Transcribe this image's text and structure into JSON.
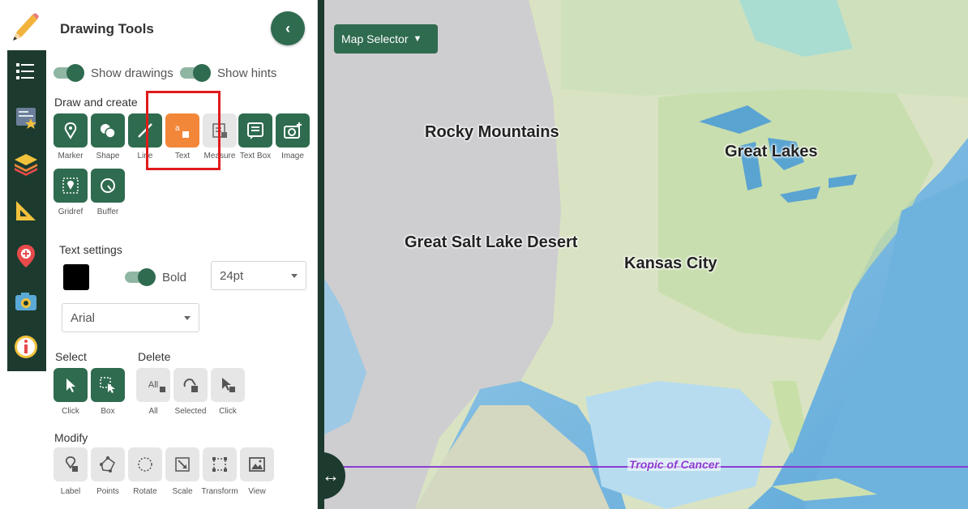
{
  "panel": {
    "title": "Drawing Tools",
    "collapse_icon": "chevron-left-icon",
    "show_drawings_label": "Show drawings",
    "show_hints_label": "Show hints"
  },
  "draw_create": {
    "heading": "Draw and create",
    "tools": [
      {
        "label": "Marker",
        "icon": "marker-icon"
      },
      {
        "label": "Shape",
        "icon": "shape-icon"
      },
      {
        "label": "Line",
        "icon": "line-icon"
      },
      {
        "label": "Text",
        "icon": "text-icon",
        "active": true
      },
      {
        "label": "Measure",
        "icon": "measure-icon"
      },
      {
        "label": "Text Box",
        "icon": "text-box-icon"
      },
      {
        "label": "Image",
        "icon": "image-icon"
      },
      {
        "label": "Gridref",
        "icon": "gridref-icon"
      },
      {
        "label": "Buffer",
        "icon": "buffer-icon"
      }
    ]
  },
  "text_settings": {
    "heading": "Text settings",
    "color": "#000000",
    "bold_label": "Bold",
    "size_value": "24pt",
    "font_value": "Arial"
  },
  "select": {
    "heading": "Select",
    "tools": [
      {
        "label": "Click",
        "icon": "cursor-icon"
      },
      {
        "label": "Box",
        "icon": "box-select-icon"
      }
    ]
  },
  "delete": {
    "heading": "Delete",
    "tools": [
      {
        "label": "All",
        "icon": "delete-all-icon",
        "glyph": "All"
      },
      {
        "label": "Selected",
        "icon": "delete-selected-icon"
      },
      {
        "label": "Click",
        "icon": "delete-click-icon"
      }
    ]
  },
  "modify": {
    "heading": "Modify",
    "tools": [
      {
        "label": "Label",
        "icon": "label-icon"
      },
      {
        "label": "Points",
        "icon": "points-icon"
      },
      {
        "label": "Rotate",
        "icon": "rotate-icon"
      },
      {
        "label": "Scale",
        "icon": "scale-icon"
      },
      {
        "label": "Transform",
        "icon": "transform-icon"
      },
      {
        "label": "View",
        "icon": "view-icon"
      }
    ]
  },
  "map": {
    "selector_label": "Map Selector",
    "labels": {
      "rocky": "Rocky Mountains",
      "lakes": "Great Lakes",
      "salt": "Great Salt Lake Desert",
      "kansas": "Kansas City"
    },
    "tropic": "Tropic of Cancer"
  },
  "colors": {
    "primary": "#2f6b4f",
    "dark": "#1d3a2e",
    "active": "#f2873a",
    "highlight": "#e01b1b",
    "tropic": "#8a3dd1"
  }
}
